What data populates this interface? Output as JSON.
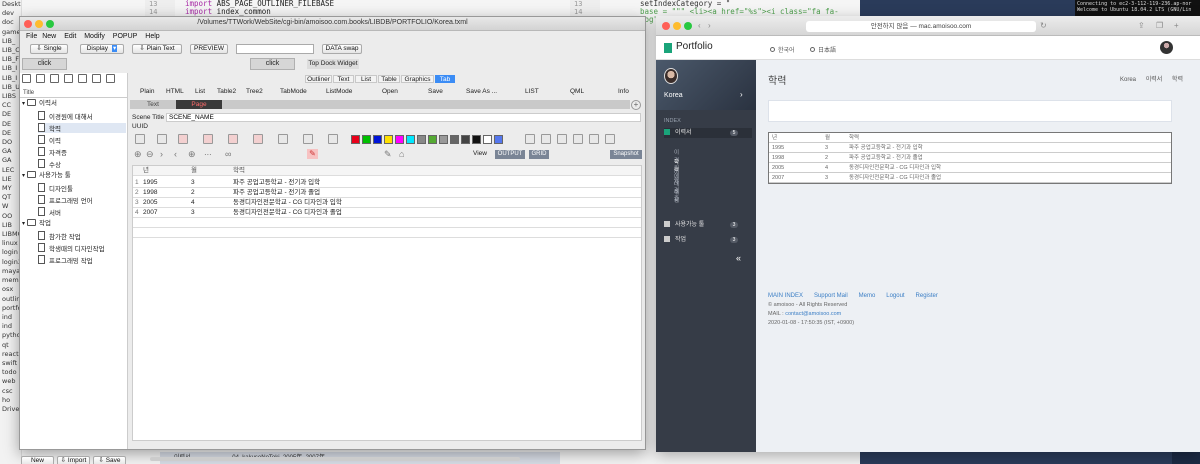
{
  "bg_editor": {
    "left_list": [
      "Desktop",
      "dev",
      "doc",
      "game",
      "LIB_",
      "LIB_C",
      "LIB_F",
      "LIB_I",
      "LIB_I",
      "LIB_U",
      "LIBS",
      "CC",
      "DE",
      "DE",
      "DE",
      "DO",
      "GA",
      "GA",
      "LEC",
      "LIE",
      "MY",
      "QT",
      "W",
      "OO",
      "LIB",
      "LIBMC",
      "linux",
      "login",
      "login3",
      "maya",
      "memo",
      "osx",
      "outlin",
      "portfo",
      "ind",
      "ind",
      "pytho",
      "qt",
      "reactr",
      "swift",
      "todo",
      "web",
      "csc",
      "ho",
      "Drive"
    ],
    "gutter1": [
      "13",
      "14"
    ],
    "code1": [
      {
        "kw": "import",
        "rest": " ABS_PAGE_OUTLINER_FILEBASE"
      },
      {
        "kw": "import",
        "rest": " index_common"
      }
    ],
    "gutter2": [
      "13",
      "14"
    ],
    "code2": [
      "setIndexCategory = \"",
      "base = \"\"\" <li><a href=\"%s\"><i class=\"fa fa-cog\"></"
    ],
    "terminal": [
      "Connecting to ec2-3-112-119-236.ap-nor",
      "Welcome to Ubuntu 18.04.2 LTS (GNU/Lin"
    ],
    "finder": [
      "이력서",
      "04_kakuseNoToki_2005年_2007年"
    ]
  },
  "app": {
    "title": "/Volumes/TTWork/WebSite/cgi-bin/amoisoo.com.books/LIBDB/PORTFOLIO/Korea.txml",
    "menu": [
      "File",
      "New",
      "Edit",
      "Modify",
      "POPUP",
      "Help"
    ],
    "toolbar": {
      "single": "Single",
      "display": "Display",
      "plain_text": "Plain Text",
      "preview": "PREVIEW",
      "data_swap": "DATA swap"
    },
    "click1": "click",
    "click2": "click",
    "top_dock": "Top Dock Widget",
    "tree_header": "Title",
    "tree": [
      {
        "label": "이력서",
        "type": "folder",
        "indent": 0
      },
      {
        "label": "이경원에 대해서",
        "type": "page",
        "indent": 1
      },
      {
        "label": "학력",
        "type": "page",
        "indent": 1,
        "selected": true
      },
      {
        "label": "이력",
        "type": "page",
        "indent": 1
      },
      {
        "label": "자격증",
        "type": "page",
        "indent": 1
      },
      {
        "label": "수상",
        "type": "page",
        "indent": 1
      },
      {
        "label": "사용가능 툴",
        "type": "folder",
        "indent": 0
      },
      {
        "label": "디자인툴",
        "type": "page",
        "indent": 1
      },
      {
        "label": "프로그래밍 언어",
        "type": "page",
        "indent": 1
      },
      {
        "label": "서버",
        "type": "page",
        "indent": 1
      },
      {
        "label": "작업",
        "type": "folder",
        "indent": 0
      },
      {
        "label": "참가한 작업",
        "type": "page",
        "indent": 1
      },
      {
        "label": "학생때의 디자인작업",
        "type": "page",
        "indent": 1
      },
      {
        "label": "프로그래밍 작업",
        "type": "page",
        "indent": 1
      }
    ],
    "bottom_buttons": {
      "new_scene": "New Scene",
      "import": "Import",
      "save": "Save"
    },
    "tabs_top": [
      "Outliner",
      "Text",
      "List",
      "Table",
      "Graphics",
      "Tab"
    ],
    "tabs_second": [
      "Plain",
      "HTML",
      "List",
      "Table2",
      "Tree2",
      "TabMode",
      "ListMode",
      "Open",
      "Save",
      "Save As ...",
      "LIST",
      "QML",
      "Info"
    ],
    "subtabs": [
      "Text",
      "Page"
    ],
    "scene_title_label": "Scene Title",
    "scene_title_value": "SCENE_NAME",
    "uuid_label": "UUID",
    "view_label": "View",
    "output_btn": "OUTPUT",
    "grid_btn": "GRID",
    "snapshot_btn": "Snapshot",
    "swatches": [
      "#e8001a",
      "#00c000",
      "#0014d8",
      "#ffe000",
      "#ff00ff",
      "#00e8ff",
      "#888888",
      "#55aa33",
      "#999999",
      "#666666",
      "#444444",
      "#111111",
      "#ffffff",
      "#5577ee"
    ],
    "grid_headers": [
      "년",
      "월",
      "학력"
    ],
    "grid_rows": [
      {
        "n": "1",
        "year": "1995",
        "month": "3",
        "text": "파주 공업고등학교 - 전기과 입학"
      },
      {
        "n": "2",
        "year": "1998",
        "month": "2",
        "text": "파주 공업고등학교 - 전기과 졸업"
      },
      {
        "n": "3",
        "year": "2005",
        "month": "4",
        "text": "동경디자인전문학교 - CG 디자인과 입학"
      },
      {
        "n": "4",
        "year": "2007",
        "month": "3",
        "text": "동경디자인전문학교 - CG 디자인과 졸업"
      }
    ]
  },
  "safari": {
    "url": "안전하지 않음 — mac.amoisoo.com",
    "logo": "Portfolio",
    "lang1": "한국어",
    "lang2": "日本語",
    "sidebar": {
      "country": "Korea",
      "index_label": "INDEX",
      "sections": [
        {
          "label": "이력서",
          "badge": "5"
        },
        {
          "label": "사용가능 툴",
          "badge": "3"
        },
        {
          "label": "작업",
          "badge": "3"
        }
      ],
      "subitems": [
        "이경원에 대해서",
        "학력",
        "이력",
        "자격증",
        "수상"
      ]
    },
    "heading": "학력",
    "breadcrumb": [
      "Korea",
      "이력서",
      "학력"
    ],
    "table_headers": [
      "년",
      "월",
      "학력"
    ],
    "table_rows": [
      {
        "year": "1995",
        "month": "3",
        "text": "파주 공업고등학교 - 전기과 입학"
      },
      {
        "year": "1998",
        "month": "2",
        "text": "파주 공업고등학교 - 전기과 졸업"
      },
      {
        "year": "2005",
        "month": "4",
        "text": "동경디자인전문학교 - CG 디자인과 입학"
      },
      {
        "year": "2007",
        "month": "3",
        "text": "동경디자인전문학교 - CG 디자인과 졸업"
      }
    ],
    "footer": {
      "links": [
        "MAIN INDEX",
        "Support Mail",
        "Memo",
        "Logout",
        "Register"
      ],
      "copyright": "© amoisoo - All Rights Reserved",
      "mail_label": "MAIL :",
      "mail": "contact@amoisoo.com",
      "timestamp": "2020-01-08 - 17:50:35 (IST, +0900)"
    }
  }
}
